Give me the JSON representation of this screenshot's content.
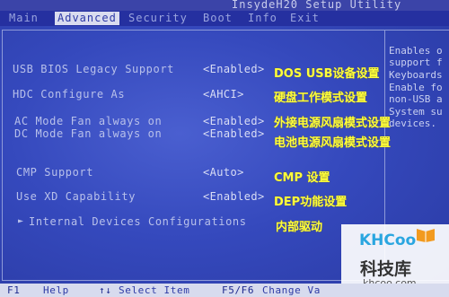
{
  "title": "InsydeH20 Setup Utility",
  "menu": {
    "main": "Main",
    "advanced": "Advanced",
    "security": "Security",
    "boot": "Boot",
    "info": "Info",
    "exit": "Exit"
  },
  "settings": [
    {
      "label": "USB BIOS Legacy Support",
      "value": "<Enabled>",
      "annotation": "DOS USB设备设置"
    },
    {
      "label": "HDC Configure As",
      "value": "<AHCI>",
      "annotation": "硬盘工作模式设置"
    },
    {
      "label": "AC Mode Fan always on",
      "value": "<Enabled>",
      "annotation": "外接电源风扇模式设置"
    },
    {
      "label": "DC Mode Fan always on",
      "value": "<Enabled>",
      "annotation": "电池电源风扇模式设置"
    },
    {
      "label": "CMP Support",
      "value": "<Auto>",
      "annotation": "CMP 设置"
    },
    {
      "label": "Use XD Capability",
      "value": "<Enabled>",
      "annotation": "DEP功能设置"
    }
  ],
  "submenu": {
    "label": "Internal Devices Configurations",
    "annotation": "内部驱动"
  },
  "help": [
    "Enables o",
    "support f",
    "Keyboards",
    "Enable fo",
    "non-USB a",
    "System su",
    "devices."
  ],
  "footer": {
    "f1_key": "F1",
    "f1_label": "Help",
    "arrows_key": "↑↓",
    "arrows_label": "Select Item",
    "f5f6_key": "F5/F6",
    "f5f6_label": "Change Va"
  },
  "watermark": {
    "brand": "KHCoo",
    "cn": "科技库",
    "url": "khcoo.com"
  }
}
